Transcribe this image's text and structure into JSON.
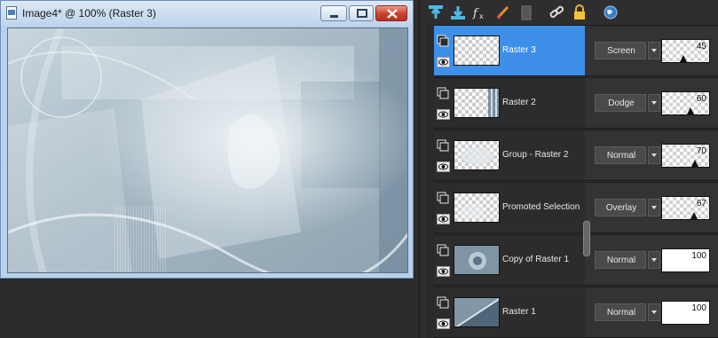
{
  "window": {
    "title": "Image4* @ 100% (Raster 3)",
    "icon": "document-icon",
    "buttons": [
      "minimize-icon",
      "maximize-icon",
      "close-icon"
    ]
  },
  "layer_toolbar": {
    "icons": [
      "new-raster-layer-icon",
      "new-vector-layer-icon",
      "fx-effects-icon",
      "brush-edit-icon",
      "delete-layer-icon",
      "link-layer-icon",
      "lock-transparency-icon",
      "globe-icon"
    ]
  },
  "layers": [
    {
      "name": "Raster 3",
      "blend_mode": "Screen",
      "opacity": "45",
      "opacity_level": 0.45,
      "selected": true
    },
    {
      "name": "Raster 2",
      "blend_mode": "Dodge",
      "opacity": "60",
      "opacity_level": 0.6,
      "selected": false
    },
    {
      "name": "Group - Raster 2",
      "blend_mode": "Normal",
      "opacity": "70",
      "opacity_level": 0.7,
      "selected": false
    },
    {
      "name": "Promoted Selection",
      "blend_mode": "Overlay",
      "opacity": "67",
      "opacity_level": 0.67,
      "selected": false
    },
    {
      "name": "Copy of Raster 1",
      "blend_mode": "Normal",
      "opacity": "100",
      "opacity_level": 1.0,
      "selected": false
    },
    {
      "name": "Raster 1",
      "blend_mode": "Normal",
      "opacity": "100",
      "opacity_level": 1.0,
      "selected": false
    }
  ],
  "colors": {
    "selection": "#3d8fe8",
    "panel_bg": "#2e2e2e",
    "close_button": "#c8412c"
  }
}
